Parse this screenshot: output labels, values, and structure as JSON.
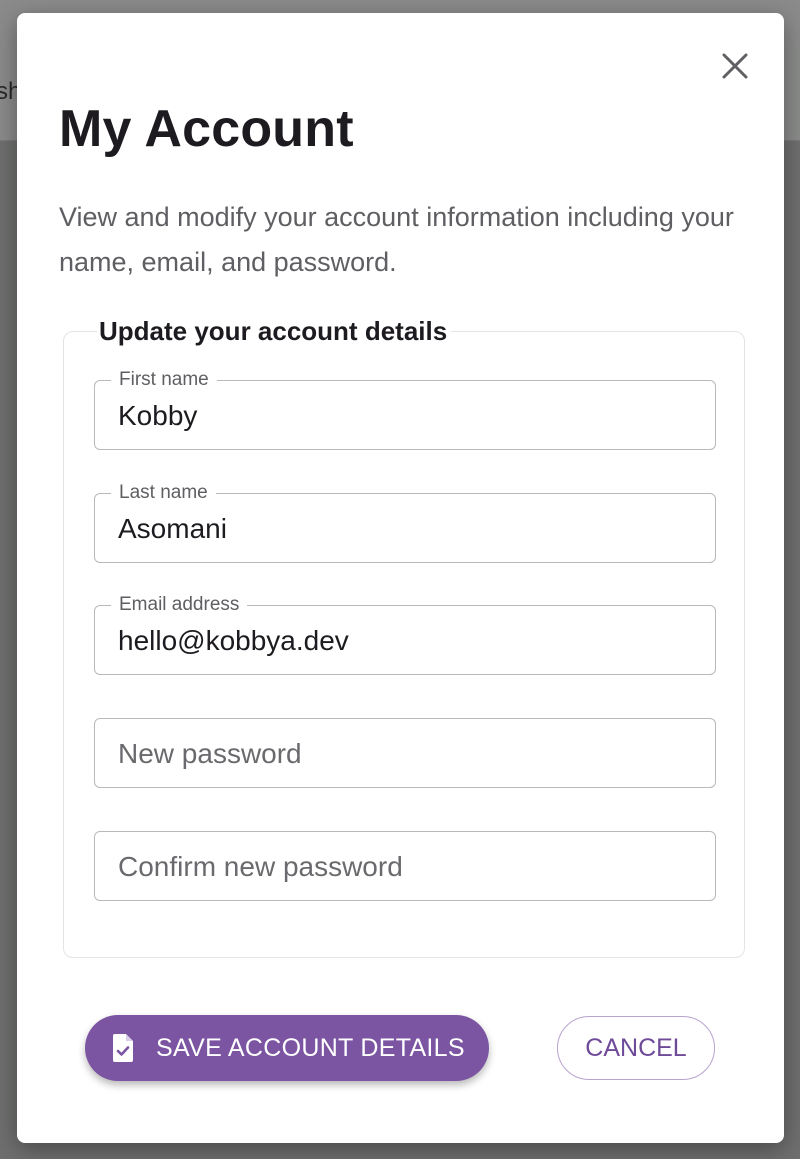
{
  "background": {
    "fragment_text": "sh"
  },
  "modal": {
    "title": "My Account",
    "description": "View and modify your account information including your name, email, and password.",
    "close_icon": "close-icon"
  },
  "form": {
    "legend": "Update your account details",
    "fields": [
      {
        "label": "First name",
        "value": "Kobby",
        "placeholder": ""
      },
      {
        "label": "Last name",
        "value": "Asomani",
        "placeholder": ""
      },
      {
        "label": "Email address",
        "value": "hello@kobbya.dev",
        "placeholder": ""
      },
      {
        "label": "",
        "value": "",
        "placeholder": "New password"
      },
      {
        "label": "",
        "value": "",
        "placeholder": "Confirm new password"
      }
    ]
  },
  "actions": {
    "save_label": "SAVE ACCOUNT DETAILS",
    "save_icon": "document-check-icon",
    "cancel_label": "CANCEL"
  },
  "colors": {
    "primary": "#7b55a2",
    "primary_text": "#6f4a99",
    "overlay": "#6e6f6e",
    "surface": "#ffffff",
    "field_border": "#b9b9bc"
  }
}
